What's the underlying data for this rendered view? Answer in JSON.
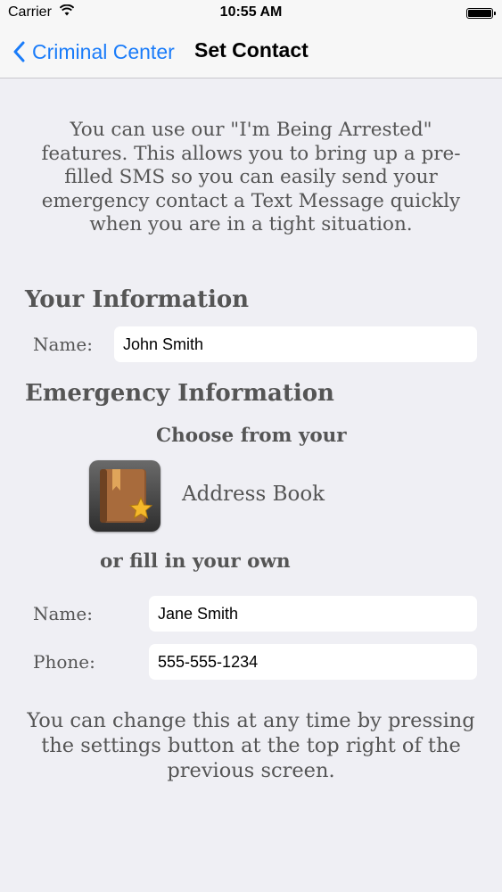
{
  "status": {
    "carrier": "Carrier",
    "time": "10:55 AM"
  },
  "nav": {
    "back_label": "Criminal Center",
    "title": "Set Contact"
  },
  "intro_text": "You can use our \"I'm Being Arrested\" features. This allows you to bring up a pre-filled SMS so you can easily send your emergency contact a Text Message quickly when you are in a tight situation.",
  "your_info": {
    "heading": "Your Information",
    "name_label": "Name:",
    "name_value": "John Smith"
  },
  "emergency": {
    "heading": "Emergency Information",
    "choose_label": "Choose from your",
    "address_book_label": "Address Book",
    "fill_label": "or fill in your own",
    "name_label": "Name:",
    "name_value": "Jane Smith",
    "phone_label": "Phone:",
    "phone_value": "555-555-1234"
  },
  "footer_text": "You can change this at any time by pressing the settings button at the top right of the previous screen.",
  "colors": {
    "accent": "#1a7cf9",
    "background": "#efeff4",
    "text": "#555555"
  },
  "icons": {
    "back": "chevron-left-icon",
    "wifi": "wifi-icon",
    "battery": "battery-icon",
    "address_book": "address-book-icon"
  }
}
